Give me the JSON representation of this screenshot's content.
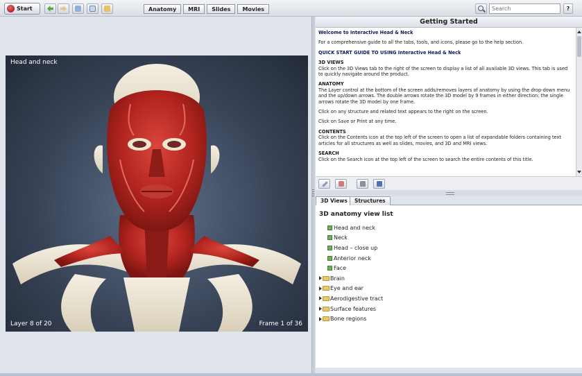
{
  "toolbar": {
    "start_label": "Start",
    "tabs": [
      "Anatomy",
      "MRI",
      "Slides",
      "Movies"
    ],
    "search_placeholder": "Search",
    "help_label": "?"
  },
  "viewer": {
    "title": "Head and neck",
    "layer": "Layer 8 of 20",
    "frame": "Frame 1 of 36"
  },
  "getting_started": {
    "header": "Getting Started",
    "welcome": "Welcome to Interactive Head & Neck",
    "intro": "For a comprehensive guide to all the tabs, tools, and icons, please go to the help section.",
    "quick_start": "QUICK START GUIDE TO USING Interactive Head & Neck",
    "sections": [
      {
        "heading": "3D VIEWS",
        "text": "Click on the 3D Views tab to the right of the screen to display a list of all available 3D views. This tab is used to quickly navigate around the product."
      },
      {
        "heading": "ANATOMY",
        "text": "The Layer control at the bottom of the screen adds/removes layers of anatomy by using the drop-down menu and the up/down arrows. The double arrows rotate the 3D model by 9 frames in either direction; the single arrows rotate the 3D model by one frame."
      },
      {
        "heading": "",
        "text": "Click on any structure and related text appears to the right on the screen."
      },
      {
        "heading": "",
        "text": "Click on Save or Print at any time."
      },
      {
        "heading": "CONTENTS",
        "text": "Click on the Contents icon at the top left of the screen to open a list of expandable folders containing text articles for all structures as well as slides, movies, and 3D and MRI views."
      },
      {
        "heading": "SEARCH",
        "text": "Click on the Search icon at the top left of the screen to search the entire contents of this title."
      }
    ]
  },
  "panel_tabs": [
    "3D Views",
    "Structures"
  ],
  "views": {
    "title": "3D anatomy view list",
    "items": [
      "Head and neck",
      "Neck",
      "Head – close up",
      "Anterior neck",
      "Face"
    ],
    "folders": [
      "Brain",
      "Eye and ear",
      "Aerodigestive tract",
      "Surface features",
      "Bone regions"
    ]
  },
  "colors": {
    "muscle": "#b3241f",
    "bone": "#ece5d6",
    "viewer_bg": "#394458"
  }
}
